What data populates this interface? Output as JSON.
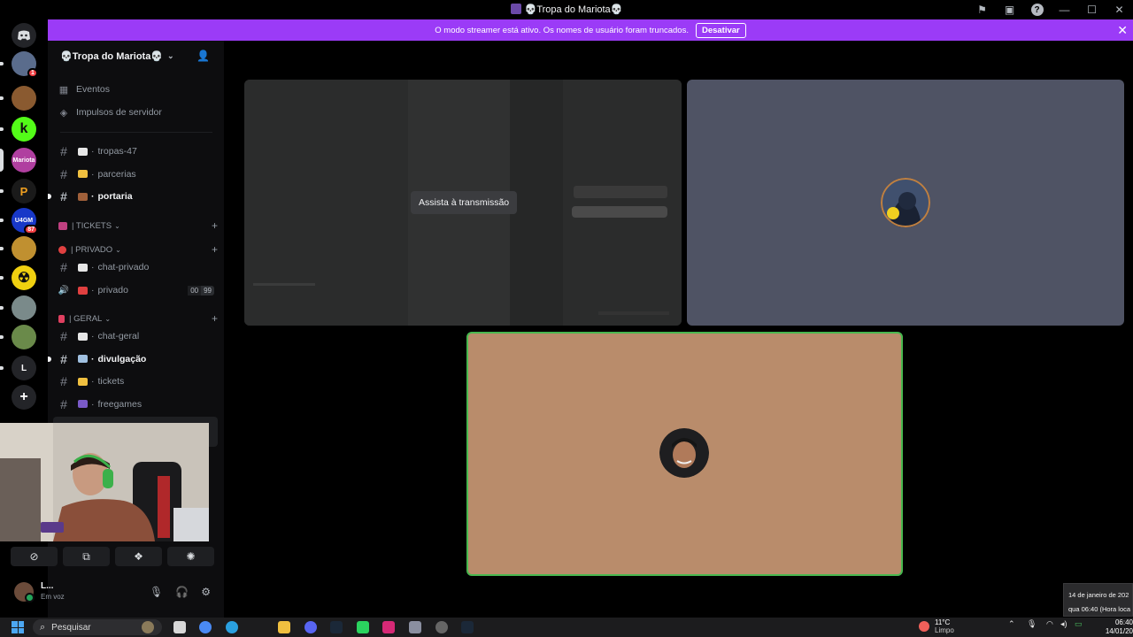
{
  "window": {
    "title": "💀Tropa do Mariota💀"
  },
  "banner": {
    "text": "O modo streamer está ativo. Os nomes de usuário foram truncados.",
    "button_label": "Desativar"
  },
  "servers": [
    {
      "name": "server-1",
      "badge": "1",
      "color": "#5a6c8c"
    },
    {
      "name": "server-2",
      "badge": "",
      "color": "#8a5a30"
    },
    {
      "name": "server-kick",
      "badge": "",
      "color": "#53fc18",
      "glyph": "k"
    },
    {
      "name": "server-mariota",
      "badge": "",
      "color": "#b03fa0",
      "glyph": "Mariota"
    },
    {
      "name": "server-p",
      "badge": "",
      "color": "#1a1a1a",
      "glyph": "P"
    },
    {
      "name": "server-u4gm",
      "badge": "87",
      "color": "#1838c8",
      "glyph": "U4GM"
    },
    {
      "name": "server-gold",
      "badge": "",
      "color": "#c09030"
    },
    {
      "name": "server-radioactive",
      "badge": "",
      "color": "#f0d010",
      "glyph": "☢"
    },
    {
      "name": "server-grey",
      "badge": "",
      "color": "#7a8a8a"
    },
    {
      "name": "server-game",
      "badge": "",
      "color": "#6a8a4a"
    },
    {
      "name": "server-l",
      "badge": "",
      "color": "#232428",
      "glyph": "L"
    },
    {
      "name": "add-server",
      "badge": "",
      "color": "#232428",
      "glyph": "+"
    }
  ],
  "sidebar": {
    "server_name": "💀Tropa do Mariota💀",
    "top_items": [
      {
        "label": "Eventos",
        "icon": "calendar-icon"
      },
      {
        "label": "Impulsos de servidor",
        "icon": "boost-icon"
      }
    ],
    "channels_top": [
      {
        "label": "tropas-47",
        "emoji": "💀",
        "emoji_color": "#e6e6e6",
        "unread": false
      },
      {
        "label": "parcerias",
        "emoji": "🤝",
        "emoji_color": "#f0c040",
        "unread": false
      },
      {
        "label": "portaria",
        "emoji": "🚪",
        "emoji_color": "#a0603a",
        "unread": true
      }
    ],
    "categories": [
      {
        "label": "| TICKETS",
        "color": "#c04080"
      },
      {
        "label": "| PRIVADO",
        "color": "#e04040"
      },
      {
        "label": "| GERAL",
        "color": "#e04060"
      }
    ],
    "channels_privado": [
      {
        "label": "chat-privado",
        "emoji": "💬",
        "emoji_color": "#e6e6e6",
        "type": "text",
        "unread": false
      },
      {
        "label": "privado",
        "emoji": "📞",
        "emoji_color": "#e04040",
        "type": "voice",
        "unread": false,
        "count_a": "00",
        "count_b": "99"
      }
    ],
    "channels_geral": [
      {
        "label": "chat-geral",
        "emoji": "💬",
        "emoji_color": "#e6e6e6",
        "unread": false
      },
      {
        "label": "divulgação",
        "emoji": "📰",
        "emoji_color": "#a0c0e0",
        "unread": true
      },
      {
        "label": "tickets",
        "emoji": "🎫",
        "emoji_color": "#f0c040",
        "unread": false
      },
      {
        "label": "freegames",
        "emoji": "🎮",
        "emoji_color": "#7a5ac8",
        "unread": false
      }
    ]
  },
  "user": {
    "name": "L...",
    "status": "Em voz"
  },
  "stage": {
    "watch_label": "Assista à transmissão"
  },
  "taskbar": {
    "search_placeholder": "Pesquisar",
    "weather_temp": "11°C",
    "weather_cond": "Limpo",
    "time": "06:40",
    "date": "14/01/20"
  },
  "tooltip": {
    "line1": "14 de janeiro de 202",
    "line2": "qua 06:40 (Hora loca"
  }
}
